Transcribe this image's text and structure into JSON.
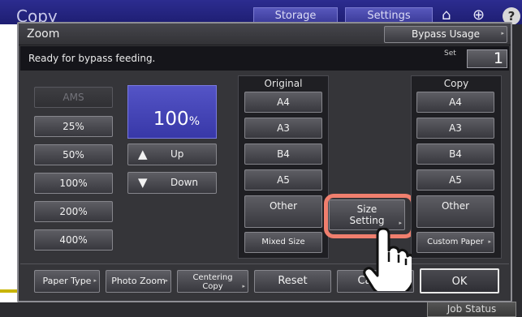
{
  "background": {
    "app_title": "Copy",
    "tabs": [
      "Storage",
      "Settings"
    ],
    "icons": [
      "home-icon",
      "globe-icon",
      "help-icon"
    ],
    "help_glyph": "?",
    "job_status_label": "Job Status"
  },
  "dialog": {
    "title": "Zoom",
    "bypass_usage_label": "Bypass Usage",
    "status_message": "Ready for bypass feeding.",
    "set_label": "Set",
    "set_value": "1"
  },
  "zoom": {
    "ams_label": "AMS",
    "presets": [
      "25%",
      "50%",
      "100%",
      "200%",
      "400%"
    ],
    "current_value": "100",
    "current_unit": "%",
    "up_label": "Up",
    "down_label": "Down"
  },
  "original": {
    "title": "Original",
    "sizes": [
      "A4",
      "A3",
      "B4",
      "A5"
    ],
    "other_label": "Other",
    "mixed_label": "Mixed Size"
  },
  "size_setting": {
    "line1": "Size",
    "line2": "Setting"
  },
  "copy": {
    "title": "Copy",
    "sizes": [
      "A4",
      "A3",
      "B4",
      "A5"
    ],
    "other_label": "Other",
    "custom_label": "Custom Paper"
  },
  "bottom": {
    "paper_type": "Paper Type",
    "photo_zoom": "Photo Zoom",
    "centering_line1": "Centering",
    "centering_line2": "Copy",
    "reset": "Reset",
    "cancel": "Cancel",
    "ok": "OK"
  },
  "colors": {
    "highlight": "#f07f6e",
    "zoom_display": "#4848b8",
    "title_bar": "#2c2c90"
  }
}
